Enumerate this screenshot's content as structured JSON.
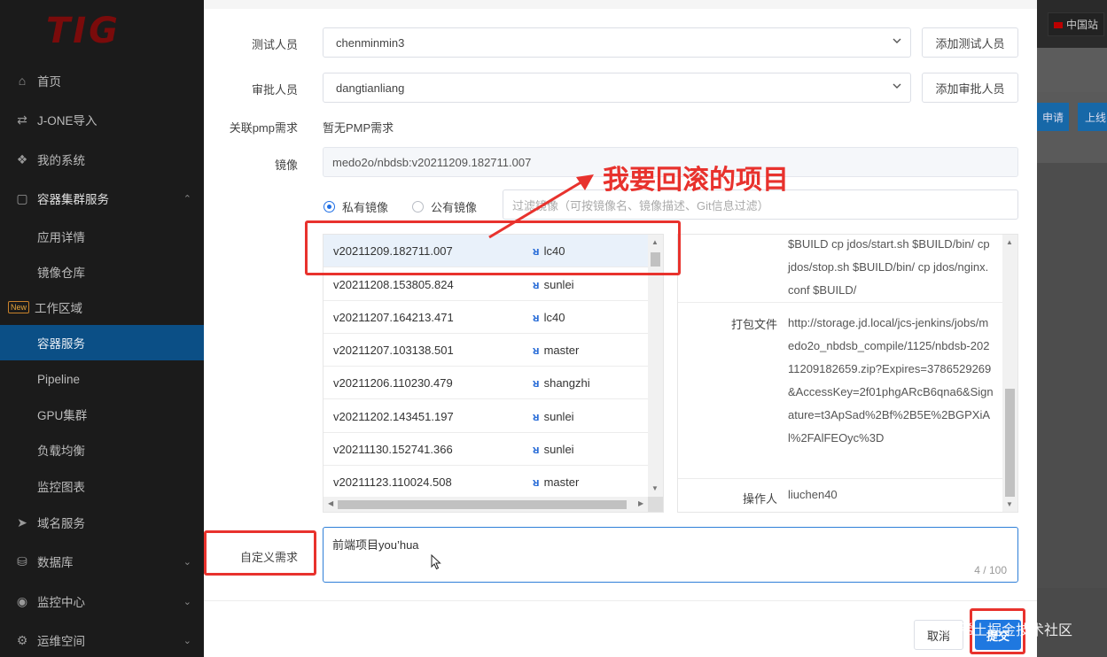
{
  "sidebar": {
    "logo": "TIG",
    "items": [
      {
        "label": "首页",
        "icon": "home-icon"
      },
      {
        "label": "J-ONE导入",
        "icon": "swap-icon"
      },
      {
        "label": "我的系统",
        "icon": "cubes-icon"
      },
      {
        "label": "容器集群服务",
        "icon": "desktop-icon"
      },
      {
        "label": "应用详情"
      },
      {
        "label": "镜像仓库"
      },
      {
        "label": "工作区域",
        "badge": "New"
      },
      {
        "label": "容器服务"
      },
      {
        "label": "Pipeline"
      },
      {
        "label": "GPU集群"
      },
      {
        "label": "负载均衡"
      },
      {
        "label": "监控图表"
      },
      {
        "label": "域名服务",
        "icon": "send-icon"
      },
      {
        "label": "数据库",
        "icon": "database-icon"
      },
      {
        "label": "监控中心",
        "icon": "eye-icon"
      },
      {
        "label": "运维空间",
        "icon": "wrench-icon"
      }
    ]
  },
  "right_bg": {
    "flag_label": "中国站",
    "btn1": "申请",
    "btn2": "上线"
  },
  "form": {
    "tester": {
      "label": "测试人员",
      "value": "chenminmin3",
      "button": "添加测试人员"
    },
    "approver": {
      "label": "审批人员",
      "value": "dangtianliang",
      "button": "添加审批人员"
    },
    "pmp": {
      "label": "关联pmp需求",
      "value": "暂无PMP需求"
    },
    "image": {
      "label": "镜像",
      "value": "medo2o/nbdsb:v20211209.182711.007"
    },
    "radio_private": "私有镜像",
    "radio_public": "公有镜像",
    "filter_placeholder": "过滤镜像（可按镜像名、镜像描述、Git信息过滤）",
    "custom": {
      "label": "自定义需求",
      "value": "前端项目you’hua",
      "counter": "4 / 100"
    }
  },
  "image_list": [
    {
      "version": "v20211209.182711.007",
      "branch": "lc40"
    },
    {
      "version": "v20211208.153805.824",
      "branch": "sunlei"
    },
    {
      "version": "v20211207.164213.471",
      "branch": "lc40"
    },
    {
      "version": "v20211207.103138.501",
      "branch": "master"
    },
    {
      "version": "v20211206.110230.479",
      "branch": "shangzhi"
    },
    {
      "version": "v20211202.143451.197",
      "branch": "sunlei"
    },
    {
      "version": "v20211130.152741.366",
      "branch": "sunlei"
    },
    {
      "version": "v20211123.110024.508",
      "branch": "master"
    }
  ],
  "details": {
    "build_cmd": "$BUILD cp jdos/start.sh $BUILD/bin/ cp jdos/stop.sh $BUILD/bin/ cp jdos/nginx.conf $BUILD/",
    "pack_label": "打包文件",
    "pack_value": "http://storage.jd.local/jcs-jenkins/jobs/medo2o_nbdsb_compile/1125/nbdsb-20211209182659.zip?Expires=3786529269&AccessKey=2f01phgARcB6qna6&Signature=t3ApSad%2Bf%2B5E%2BGPXiAl%2FAlFEOyc%3D",
    "operator_label": "操作人",
    "operator_value": "liuchen40"
  },
  "footer": {
    "cancel": "取消",
    "submit": "提交"
  },
  "annotation": {
    "text": "我要回滚的项目"
  },
  "watermark": "@稀土掘金技术社区",
  "colors": {
    "accent": "#1f78e0",
    "annotation": "#e8322d",
    "sidebar_active": "#0b4f86"
  }
}
